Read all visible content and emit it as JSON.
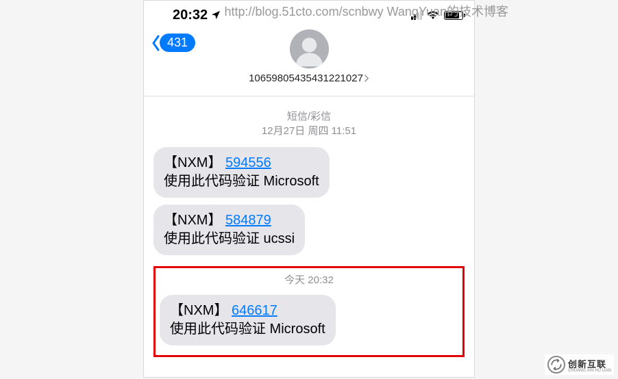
{
  "watermark": "http://blog.51cto.com/scnbwy WangYuan的技术博客",
  "status_bar": {
    "time": "20:32",
    "location_arrow": "➤"
  },
  "nav": {
    "back_count": "431",
    "contact_number": "10659805435431221027"
  },
  "messages": {
    "section1": {
      "label": "短信/彩信",
      "date": "12月27日 周四 11:51"
    },
    "msg1": {
      "prefix": "【NXM】",
      "code": "594556",
      "body": "使用此代码验证 Microsoft"
    },
    "msg2": {
      "prefix": "【NXM】",
      "code": "584879",
      "body": "使用此代码验证 ucssi"
    },
    "section2": {
      "date": "今天 20:32"
    },
    "msg3": {
      "prefix": "【NXM】",
      "code": "646617",
      "body": "使用此代码验证 Microsoft"
    }
  },
  "bottom_logo": {
    "main": "创新互联",
    "sub": "CHUANG XIN HU LIAN"
  }
}
